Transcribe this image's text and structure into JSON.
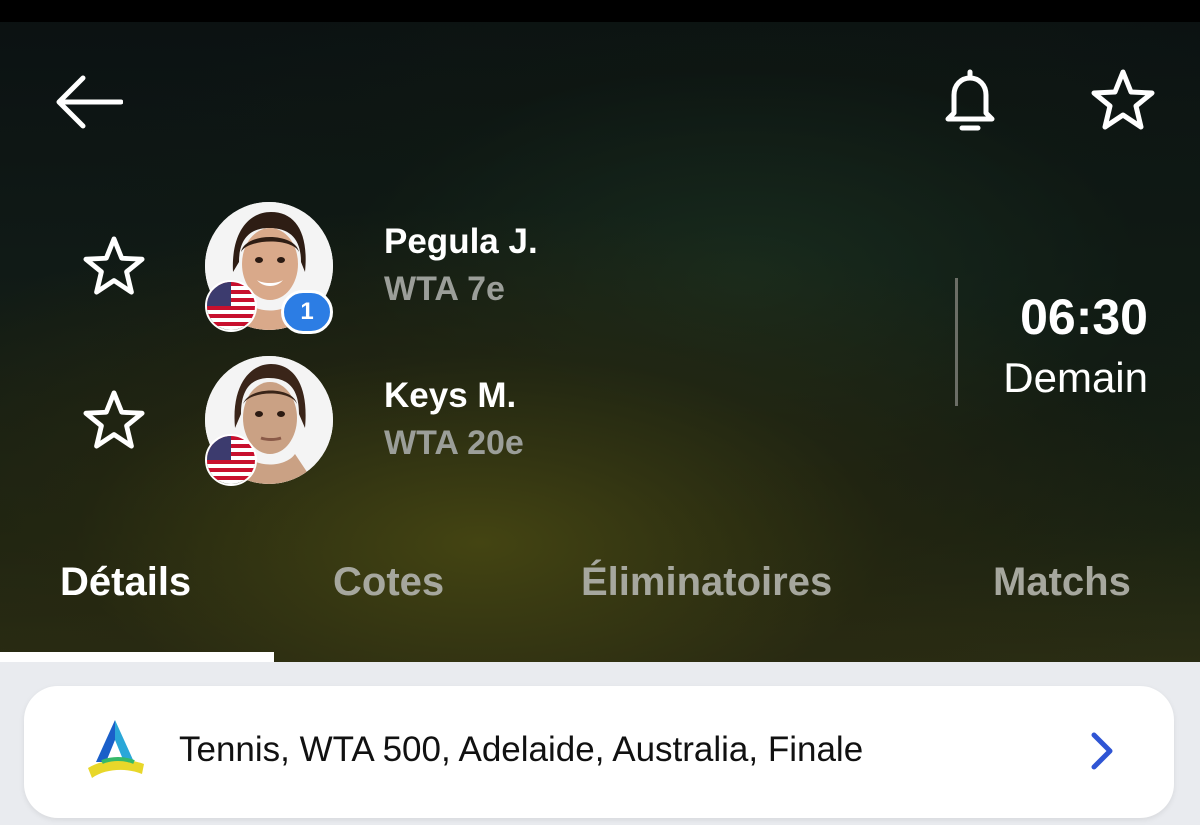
{
  "nav": {
    "back_icon": "arrow-left-icon",
    "bell_icon": "bell-icon",
    "favorite_icon": "star-outline-icon"
  },
  "players": [
    {
      "name": "Pegula J.",
      "rank": "WTA 7e",
      "seed": "1",
      "flag": "usa-flag-icon"
    },
    {
      "name": "Keys M.",
      "rank": "WTA 20e",
      "seed": "",
      "flag": "usa-flag-icon"
    }
  ],
  "match": {
    "time": "06:30",
    "day": "Demain"
  },
  "tabs": [
    {
      "label": "Détails",
      "active": true
    },
    {
      "label": "Cotes",
      "active": false
    },
    {
      "label": "Éliminatoires",
      "active": false
    },
    {
      "label": "Matchs",
      "active": false
    }
  ],
  "tournament": {
    "label": "Tennis, WTA 500, Adelaide, Australia, Finale",
    "logo": "adelaide-tournament-logo",
    "chevron": "chevron-right-icon"
  },
  "colors": {
    "accent_blue": "#2c7de4",
    "chevron_blue": "#2f55d4",
    "inactive_tab": "#a6a79e"
  }
}
